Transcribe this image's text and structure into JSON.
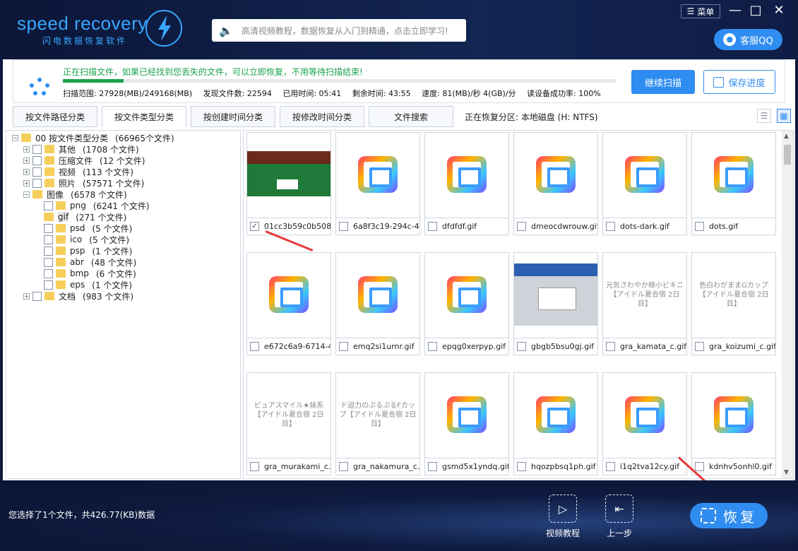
{
  "header": {
    "logo_text": "speed recovery",
    "logo_sub": "闪电数据恢复软件",
    "search_text": "高清视频教程，数据恢复从入门到精通，点击立即学习!",
    "menu_label": "菜单",
    "minimize": "—",
    "maximize": "□",
    "close": "✕",
    "qq_label": "客服QQ"
  },
  "scan": {
    "message": "正在扫描文件，如果已经找到您丢失的文件，可以立即恢复，不用等待扫描结束!",
    "progress": 0.11,
    "range": "扫描范围: 27928(MB)/249168(MB)",
    "found": "发现文件数: 22594",
    "elapsed": "已用时间: 05:41",
    "remaining": "剩余时间: 43:55",
    "speed": "速度: 81(MB)/秒  4(GB)/分",
    "success_rate": "读设备成功率: 100%",
    "continue_label": "继续扫描",
    "save_label": "保存进度"
  },
  "tabs": [
    "按文件路径分类",
    "按文件类型分类",
    "按创建时间分类",
    "按修改时间分类",
    "文件搜索"
  ],
  "active_tab": 1,
  "partition_info": "正在恢复分区: 本地磁盘 (H: NTFS)",
  "tree": [
    {
      "pm": "⊟",
      "label": "00  按文件类型分类",
      "count": "(66965个文件)",
      "level": 0,
      "checked": "partial"
    },
    {
      "pm": "⊞",
      "label": "其他",
      "count": "(1708 个文件)",
      "level": 1,
      "checked": "no"
    },
    {
      "pm": "⊞",
      "label": "压缩文件",
      "count": "(12 个文件)",
      "level": 1,
      "checked": "no"
    },
    {
      "pm": "⊞",
      "label": "视频",
      "count": "(113 个文件)",
      "level": 1,
      "checked": "no"
    },
    {
      "pm": "⊞",
      "label": "照片",
      "count": "(57571 个文件)",
      "level": 1,
      "checked": "no"
    },
    {
      "pm": "⊟",
      "label": "图像",
      "count": "(6578 个文件)",
      "level": 1,
      "checked": "partial"
    },
    {
      "pm": "",
      "label": "png",
      "count": "(6241 个文件)",
      "level": 2,
      "checked": "no"
    },
    {
      "pm": "",
      "label": "gif",
      "count": "(271 个文件)",
      "level": 2,
      "checked": "partial",
      "selected": true
    },
    {
      "pm": "",
      "label": "psd",
      "count": "(5 个文件)",
      "level": 2,
      "checked": "no"
    },
    {
      "pm": "",
      "label": "ico",
      "count": "(5 个文件)",
      "level": 2,
      "checked": "no"
    },
    {
      "pm": "",
      "label": "psp",
      "count": "(1 个文件)",
      "level": 2,
      "checked": "no"
    },
    {
      "pm": "",
      "label": "abr",
      "count": "(48 个文件)",
      "level": 2,
      "checked": "no"
    },
    {
      "pm": "",
      "label": "bmp",
      "count": "(6 个文件)",
      "level": 2,
      "checked": "no"
    },
    {
      "pm": "",
      "label": "eps",
      "count": "(1 个文件)",
      "level": 2,
      "checked": "no"
    },
    {
      "pm": "⊞",
      "label": "文档",
      "count": "(983 个文件)",
      "level": 1,
      "checked": "no"
    }
  ],
  "files": [
    {
      "name": "01cc3b59c0b508...",
      "thumb": "game",
      "checked": true
    },
    {
      "name": "6a8f3c19-294c-4...",
      "thumb": "gif"
    },
    {
      "name": "dfdfdf.gif",
      "thumb": "gif"
    },
    {
      "name": "dmeocdwrouw.gif",
      "thumb": "gif"
    },
    {
      "name": "dots-dark.gif",
      "thumb": "gif"
    },
    {
      "name": "dots.gif",
      "thumb": "gif"
    },
    {
      "name": "e672c6a9-6714-4...",
      "thumb": "gif"
    },
    {
      "name": "emq2si1urnr.gif",
      "thumb": "gif"
    },
    {
      "name": "epqg0xerpyp.gif",
      "thumb": "gif"
    },
    {
      "name": "gbgb5bsu0gj.gif",
      "thumb": "shot"
    },
    {
      "name": "gra_kamata_c.gif",
      "thumb": "text",
      "text": "元気さわやか極小ビキニ【アイドル夏合宿 2日目】"
    },
    {
      "name": "gra_koizumi_c.gif",
      "thumb": "text",
      "text": "色白わがままGカップ【アイドル夏合宿 2日目】"
    },
    {
      "name": "gra_murakami_c.gif",
      "thumb": "text",
      "text": "ピュアスマイル★妹系【アイドル夏合宿 2日目】"
    },
    {
      "name": "gra_nakamura_c.gif",
      "thumb": "text",
      "text": "ド迫力のぷるぷるFカップ【アイドル夏合宿 2日目】"
    },
    {
      "name": "gsmd5x1yndq.gif",
      "thumb": "gif"
    },
    {
      "name": "hqozpbsq1ph.gif",
      "thumb": "gif"
    },
    {
      "name": "i1q2tva12cy.gif",
      "thumb": "gif"
    },
    {
      "name": "kdnhv5onhl0.gif",
      "thumb": "gif"
    }
  ],
  "footer": {
    "selection": "您选择了1个文件，共426.77(KB)数据",
    "video_label": "视频教程",
    "back_label": "上一步",
    "recover_label": "恢复"
  },
  "colors": {
    "accent": "#2f8cf0",
    "progress": "#1aa34a",
    "arrow": "#e53a3a"
  }
}
